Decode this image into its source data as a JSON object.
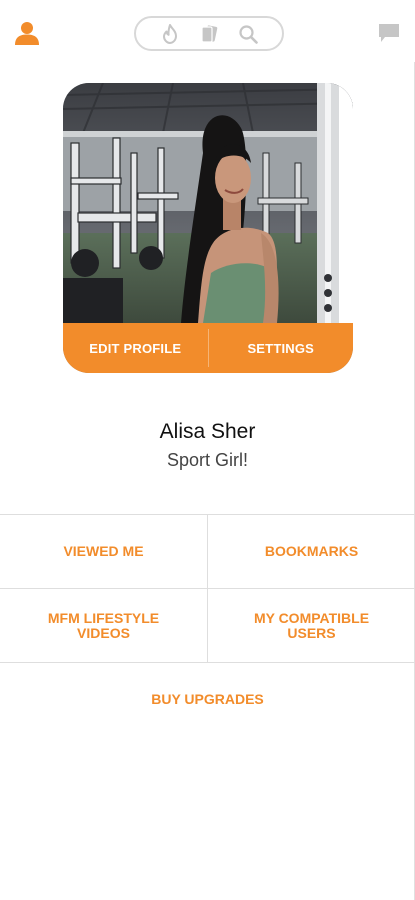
{
  "colors": {
    "accent": "#f28c2b",
    "icon_grey": "#c6c6c6",
    "divider": "#dedede"
  },
  "topbar": {
    "profile_icon": "user-icon",
    "nav_icons": [
      "flame-icon",
      "cards-icon",
      "search-icon"
    ],
    "chat_icon": "chat-bubble-icon"
  },
  "profile_card": {
    "photo": "woman-in-gym-photo",
    "edit_label": "EDIT PROFILE",
    "settings_label": "SETTINGS"
  },
  "user": {
    "name": "Alisa Sher",
    "tagline": "Sport Girl!"
  },
  "menu": {
    "viewed_me": "VIEWED ME",
    "bookmarks": "BOOKMARKS",
    "mfm_line1": "MFM LIFESTYLE",
    "mfm_line2": "VIDEOS",
    "compatible_line1": "MY COMPATIBLE",
    "compatible_line2": "USERS",
    "buy_upgrades": "BUY UPGRADES"
  }
}
